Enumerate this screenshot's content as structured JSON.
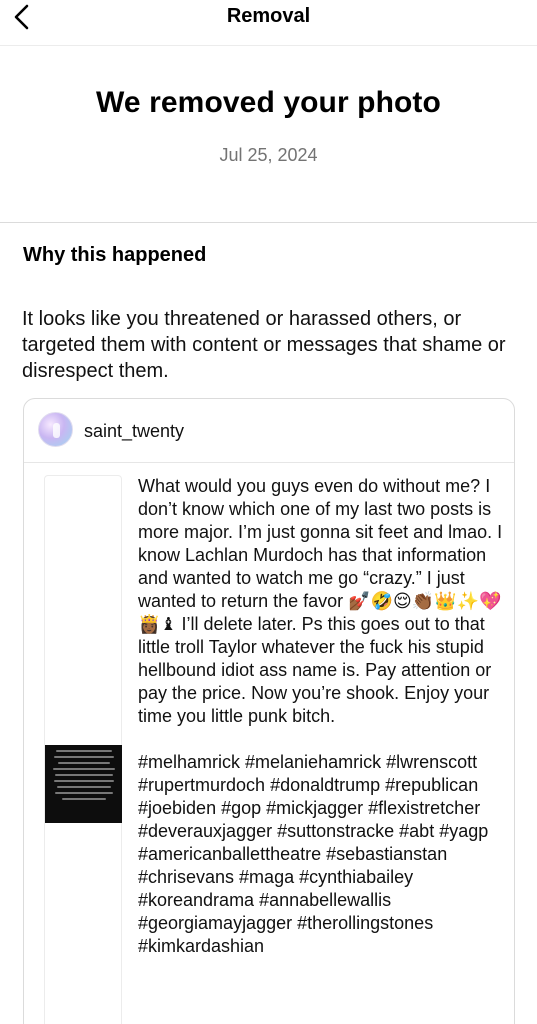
{
  "nav": {
    "title": "Removal"
  },
  "hero": {
    "title": "We removed your photo",
    "date": "Jul 25, 2024"
  },
  "section": {
    "heading": "Why this happened",
    "reason": "It looks like you threatened or harassed others, or targeted them with content or messages that shame or disrespect them."
  },
  "post": {
    "username": "saint_twenty",
    "caption": "What would you guys even do without me? I don’t know which one of my last two posts is more major. I’m just gonna sit feet and lmao. I know Lachlan Murdoch has that information and wanted to watch me go “crazy.” I just wanted to return the favor 💅🏾🤣😌👏🏾👑✨💖👸🏾♝ I’ll delete later. Ps this goes out to that little troll Taylor whatever the fuck his stupid hellbound idiot ass name is. Pay attention or pay the price. Now you’re shook. Enjoy your time you little punk bitch.",
    "hashtags": "#melhamrick #melaniehamrick #lwrenscott #rupertmurdoch #donaldtrump #republican #joebiden #gop #mickjagger #flexistretcher #deverauxjagger #suttonstracke #abt #yagp #americanballettheatre #sebastianstan #chrisevans #maga #cynthiabailey #koreandrama #annabellewallis #georgiamayjagger #therollingstones #kimkardashian"
  }
}
